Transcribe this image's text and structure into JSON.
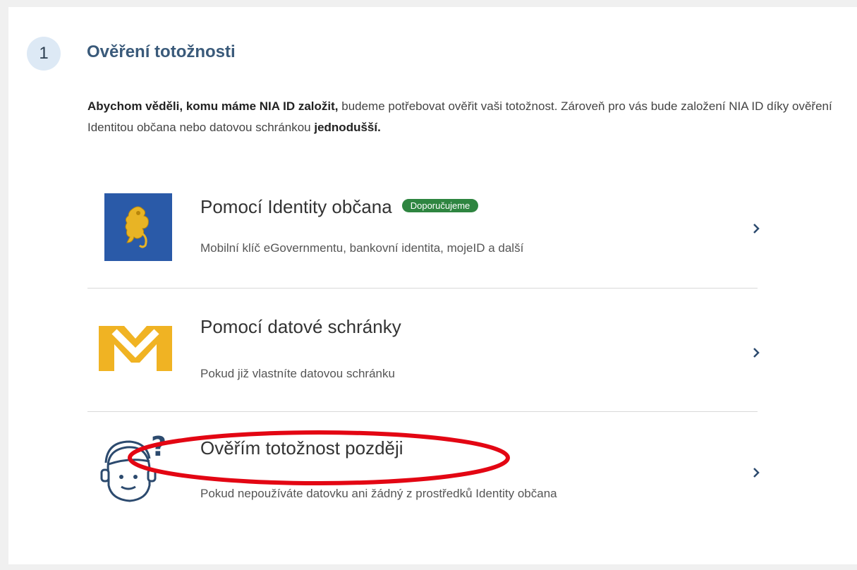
{
  "step": {
    "number": "1",
    "title": "Ověření totožnosti"
  },
  "intro": {
    "bold1": "Abychom věděli, komu máme NIA ID založit,",
    "text1": " budeme potřebovat ověřit vaši totožnost. Zároveň pro vás bude založení NIA ID díky ověření Identitou občana nebo datovou schránkou ",
    "bold2": "jednodušší."
  },
  "options": [
    {
      "label": "Pomocí Identity občana",
      "badge": "Doporučujeme",
      "sub": "Mobilní klíč eGovernmentu, bankovní identita, mojeID a další",
      "icon": "czech-lion-emblem-icon"
    },
    {
      "label": "Pomocí datové schránky",
      "sub": "Pokud již vlastníte datovou schránku",
      "icon": "datova-schranka-logo-icon"
    },
    {
      "label": "Ověřím totožnost později",
      "sub": "Pokud nepoužíváte datovku ani žádný z prostředků Identity občana",
      "icon": "question-face-icon"
    }
  ],
  "colors": {
    "step_title": "#3a5a7a",
    "badge_green": "#2e8540",
    "emblem_blue": "#2a5aa8",
    "mailbox_yellow": "#f0b323",
    "annotation_red": "#e30613",
    "chevron": "#2c4a6e"
  }
}
